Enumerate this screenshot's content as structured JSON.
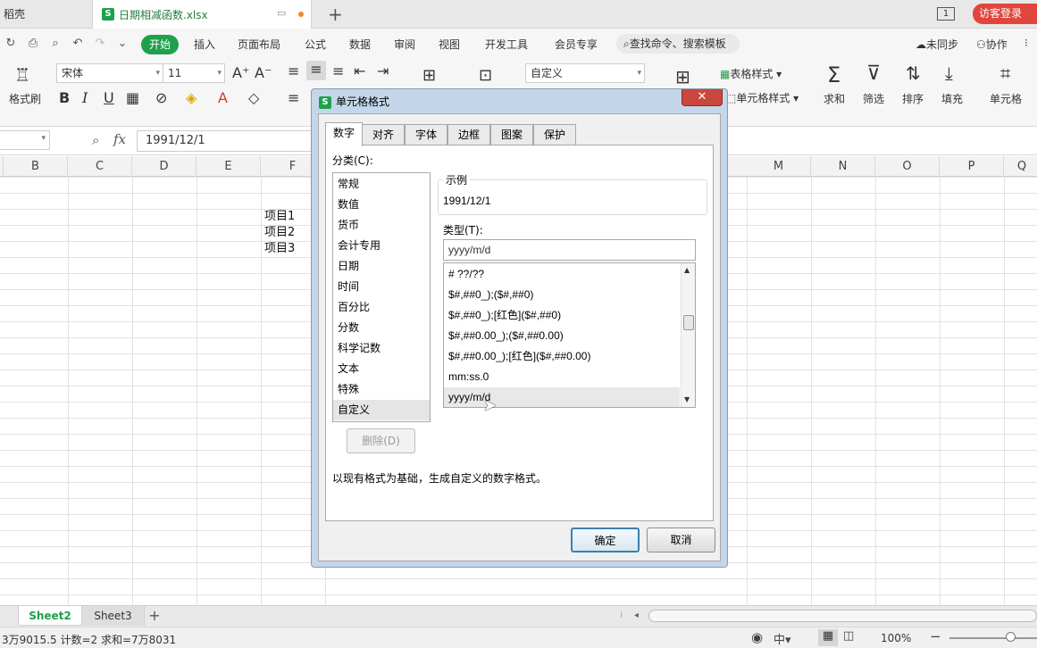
{
  "titlebar": {
    "app_tab": "稻壳",
    "file_tab": "日期相减函数.xlsx",
    "page_badge": "1",
    "login_button": "访客登录"
  },
  "menubar": {
    "items": [
      "开始",
      "插入",
      "页面布局",
      "公式",
      "数据",
      "审阅",
      "视图",
      "开发工具",
      "会员专享"
    ],
    "search_placeholder": "查找命令、搜索模板",
    "sync": "未同步",
    "collab": "协作"
  },
  "ribbon": {
    "format_painter": "格式刷",
    "font_name": "宋体",
    "font_size": "11",
    "number_format": "自定义",
    "table_style": "表格样式",
    "cell_style": "单元格样式",
    "sum": "求和",
    "filter": "筛选",
    "sort": "排序",
    "fill": "填充",
    "cell": "单元格"
  },
  "formula_bar": {
    "fx": "fx",
    "value": "1991/12/1"
  },
  "grid": {
    "columns": [
      "B",
      "C",
      "D",
      "E",
      "F",
      "M",
      "N",
      "O",
      "P",
      "Q"
    ],
    "cells": [
      "项目1",
      "项目2",
      "项目3"
    ]
  },
  "sheets": {
    "tabs": [
      "Sheet2",
      "Sheet3"
    ],
    "active": "Sheet2"
  },
  "status": {
    "text": "3万9015.5  计数=2  求和=7万8031",
    "zoom": "100%"
  },
  "dialog": {
    "title": "单元格格式",
    "close": "✕",
    "tabs": [
      "数字",
      "对齐",
      "字体",
      "边框",
      "图案",
      "保护"
    ],
    "category_label": "分类(C):",
    "categories": [
      "常规",
      "数值",
      "货币",
      "会计专用",
      "日期",
      "时间",
      "百分比",
      "分数",
      "科学记数",
      "文本",
      "特殊",
      "自定义"
    ],
    "selected_category": "自定义",
    "sample_label": "示例",
    "sample_value": "1991/12/1",
    "type_label": "类型(T):",
    "type_value": "yyyy/m/d",
    "type_list": [
      "# ??/??",
      "$#,##0_);($#,##0)",
      "$#,##0_);[红色]($#,##0)",
      "$#,##0.00_);($#,##0.00)",
      "$#,##0.00_);[红色]($#,##0.00)",
      "mm:ss.0",
      "yyyy/m/d"
    ],
    "delete_button": "删除(D)",
    "description": "以现有格式为基础，生成自定义的数字格式。",
    "ok_button": "确定",
    "cancel_button": "取消"
  }
}
